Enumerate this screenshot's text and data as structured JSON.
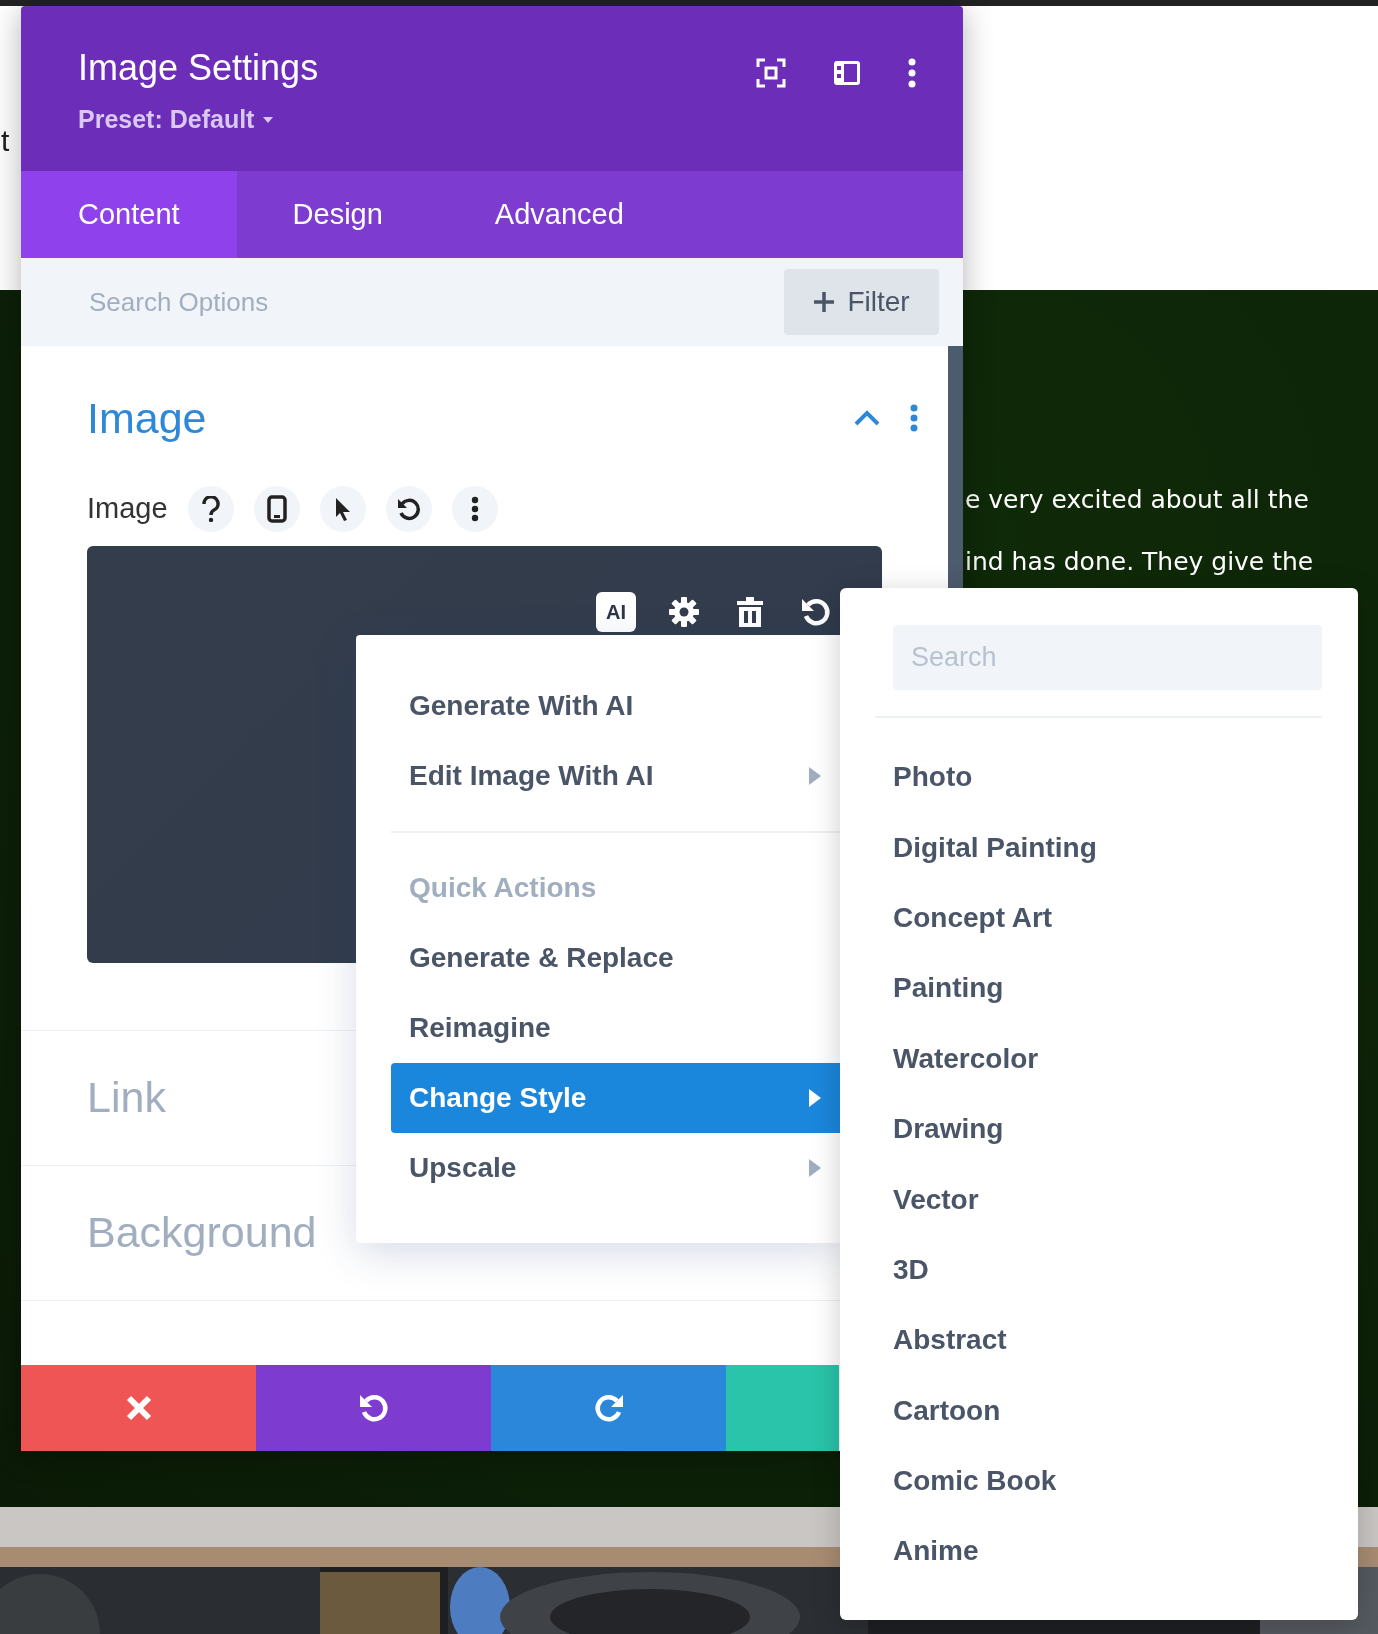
{
  "page": {
    "corner_text": "t",
    "quote_lines": [
      "e very excited about all the",
      "ind has done. They give the"
    ]
  },
  "settings": {
    "title": "Image Settings",
    "preset": "Preset: Default",
    "tabs": [
      {
        "label": "Content",
        "selected": true
      },
      {
        "label": "Design",
        "selected": false
      },
      {
        "label": "Advanced",
        "selected": false
      }
    ],
    "search": {
      "placeholder": "Search Options"
    },
    "filter": "Filter",
    "section": {
      "title": "Image",
      "expanded": true
    },
    "field_label": "Image",
    "ai_badge": "AI",
    "sections": [
      "Link",
      "Background"
    ]
  },
  "context_menu": {
    "items": [
      {
        "kind": "action",
        "label": "Generate With AI",
        "submenu": false,
        "selected": false
      },
      {
        "kind": "action",
        "label": "Edit Image With AI",
        "submenu": true,
        "selected": false
      },
      {
        "kind": "divider"
      },
      {
        "kind": "header",
        "label": "Quick Actions"
      },
      {
        "kind": "action",
        "label": "Generate & Replace",
        "submenu": false,
        "selected": false
      },
      {
        "kind": "action",
        "label": "Reimagine",
        "submenu": false,
        "selected": false
      },
      {
        "kind": "action",
        "label": "Change Style",
        "submenu": true,
        "selected": true
      },
      {
        "kind": "action",
        "label": "Upscale",
        "submenu": true,
        "selected": false
      }
    ]
  },
  "style_menu": {
    "search": {
      "placeholder": "Search"
    },
    "items": [
      {
        "label": "Photo",
        "selected": false
      },
      {
        "label": "Digital Painting",
        "selected": false
      },
      {
        "label": "Concept Art",
        "selected": false
      },
      {
        "label": "Painting",
        "selected": false
      },
      {
        "label": "Watercolor",
        "selected": false
      },
      {
        "label": "Drawing",
        "selected": false
      },
      {
        "label": "Vector",
        "selected": false
      },
      {
        "label": "3D",
        "selected": false
      },
      {
        "label": "Abstract",
        "selected": false
      },
      {
        "label": "Cartoon",
        "selected": false
      },
      {
        "label": "Comic Book",
        "selected": false
      },
      {
        "label": "Anime",
        "selected": false
      }
    ]
  }
}
